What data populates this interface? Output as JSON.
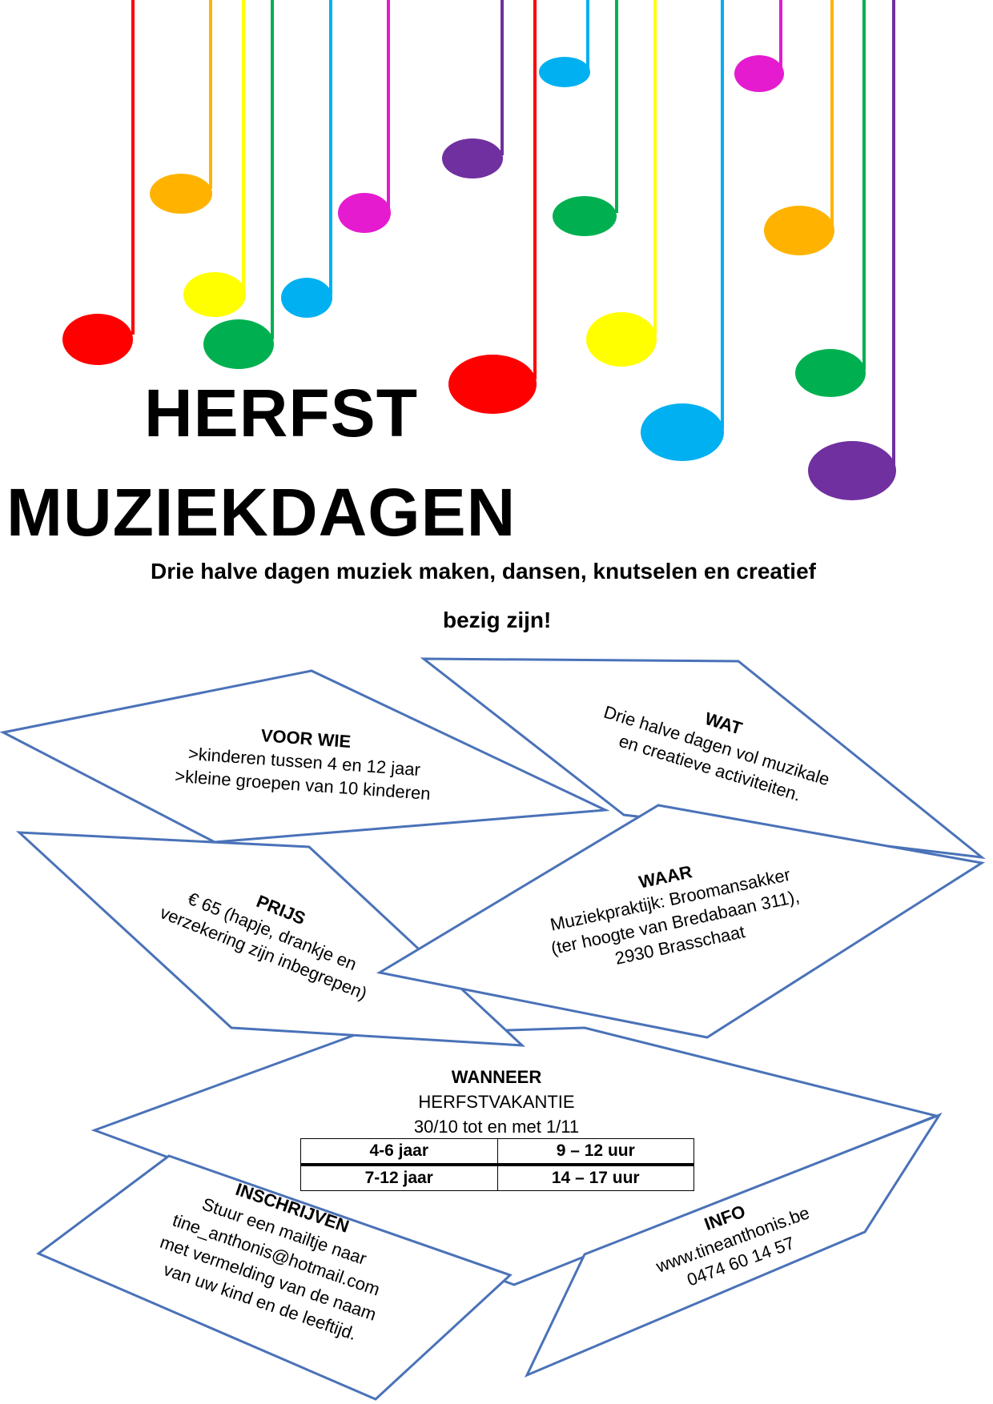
{
  "title": {
    "line1": "HERFST",
    "line2": "MUZIEKDAGEN"
  },
  "subtitle": {
    "line1": "Drie halve dagen muziek maken, dansen, knutselen en creatief",
    "line2": "bezig zijn!"
  },
  "voor_wie": {
    "heading": "VOOR WIE",
    "line1": ">kinderen tussen 4 en 12 jaar",
    "line2": ">kleine groepen van 10 kinderen"
  },
  "wat": {
    "heading": "WAT",
    "line1": "Drie halve dagen vol muzikale",
    "line2": "en creatieve activiteiten."
  },
  "prijs": {
    "heading": "PRIJS",
    "line1": "€ 65 (hapje, drankje en",
    "line2": "verzekering zijn inbegrepen)"
  },
  "waar": {
    "heading": "WAAR",
    "line1": "Muziekpraktijk: Broomansakker",
    "line2": "(ter hoogte van Bredabaan 311),",
    "line3": "2930 Brasschaat"
  },
  "wanneer": {
    "heading": "WANNEER",
    "line1": "HERFSTVAKANTIE",
    "line2": "30/10 tot en met 1/11",
    "schedule": [
      {
        "age": "4-6 jaar",
        "time": "9 – 12 uur"
      },
      {
        "age": "7-12 jaar",
        "time": "14 – 17 uur"
      }
    ]
  },
  "inschrijven": {
    "heading": "INSCHRIJVEN",
    "line1": "Stuur een mailtje naar",
    "line2": "tine_anthonis@hotmail.com",
    "line3": "met vermelding van de naam",
    "line4": "van uw kind en de leeftijd."
  },
  "info": {
    "heading": "INFO",
    "line1": "www.tineanthonis.be",
    "line2": "0474 60 14 57"
  },
  "colors": {
    "outline": "#4a72b8",
    "red": "#ff0000",
    "orange": "#ffb300",
    "yellow": "#ffff00",
    "green": "#00b050",
    "blue": "#00b0f0",
    "magenta": "#e51bd0",
    "purple": "#7030a0"
  }
}
